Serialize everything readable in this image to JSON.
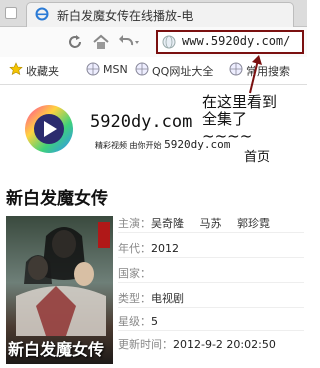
{
  "browser": {
    "tab_title": "新白发魔女传在线播放-电",
    "url": "www.5920dy.com/",
    "bookmarks": [
      "收藏夹",
      "MSN",
      "QQ网址大全",
      "常用搜索"
    ]
  },
  "site": {
    "name": "5920dy.com",
    "tagline": "精彩视频 由你开始",
    "tagline_url": "5920dy.com",
    "home_link": "首页"
  },
  "annotation": {
    "line1": "在这里看到",
    "line2": "全集了~~~~"
  },
  "video": {
    "title": "新白发魔女传",
    "poster_caption": "新白发魔女传",
    "details": [
      {
        "label": "主演：",
        "values": [
          "吴奇隆",
          "马苏",
          "郭珍霓"
        ]
      },
      {
        "label": "年代：",
        "value": "2012"
      },
      {
        "label": "国家：",
        "value": ""
      },
      {
        "label": "类型：",
        "value": "电视剧"
      },
      {
        "label": "星级：",
        "value": "5"
      },
      {
        "label": "更新时间：",
        "value": "2012-9-2 20:02:50"
      }
    ]
  },
  "colors": {
    "url_highlight": "#7a1010",
    "arrow": "#7a1010"
  }
}
